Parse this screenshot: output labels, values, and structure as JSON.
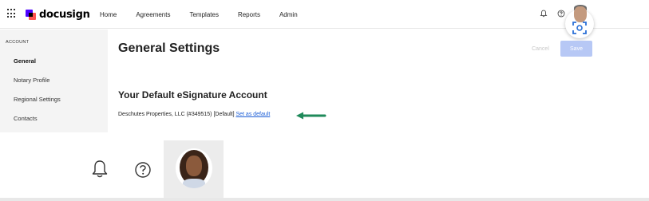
{
  "app": {
    "brand": "docusign"
  },
  "nav": {
    "items": [
      {
        "label": "Home"
      },
      {
        "label": "Agreements"
      },
      {
        "label": "Templates"
      },
      {
        "label": "Reports"
      },
      {
        "label": "Admin"
      }
    ]
  },
  "sidebar": {
    "heading": "ACCOUNT",
    "items": [
      {
        "label": "General",
        "active": true
      },
      {
        "label": "Notary Profile"
      },
      {
        "label": "Regional Settings"
      },
      {
        "label": "Contacts"
      }
    ]
  },
  "main": {
    "title": "General Settings",
    "cancel_label": "Cancel",
    "save_label": "Save",
    "section_title": "Your Default eSignature Account",
    "account_text": "Deschutes Properties, LLC (#349515) [Default]",
    "set_default_link": "Set as default"
  },
  "colors": {
    "brand_purple": "#4c00ff",
    "brand_coral": "#ff5252",
    "link": "#1d5fd6",
    "save_disabled": "#b7c8f5",
    "arrow": "#1f8a5a",
    "capture_icon": "#2a6fd6"
  },
  "icons": [
    "app-grid-icon",
    "bell-icon",
    "help-icon",
    "avatar",
    "screen-capture-icon",
    "arrow-left-icon"
  ]
}
